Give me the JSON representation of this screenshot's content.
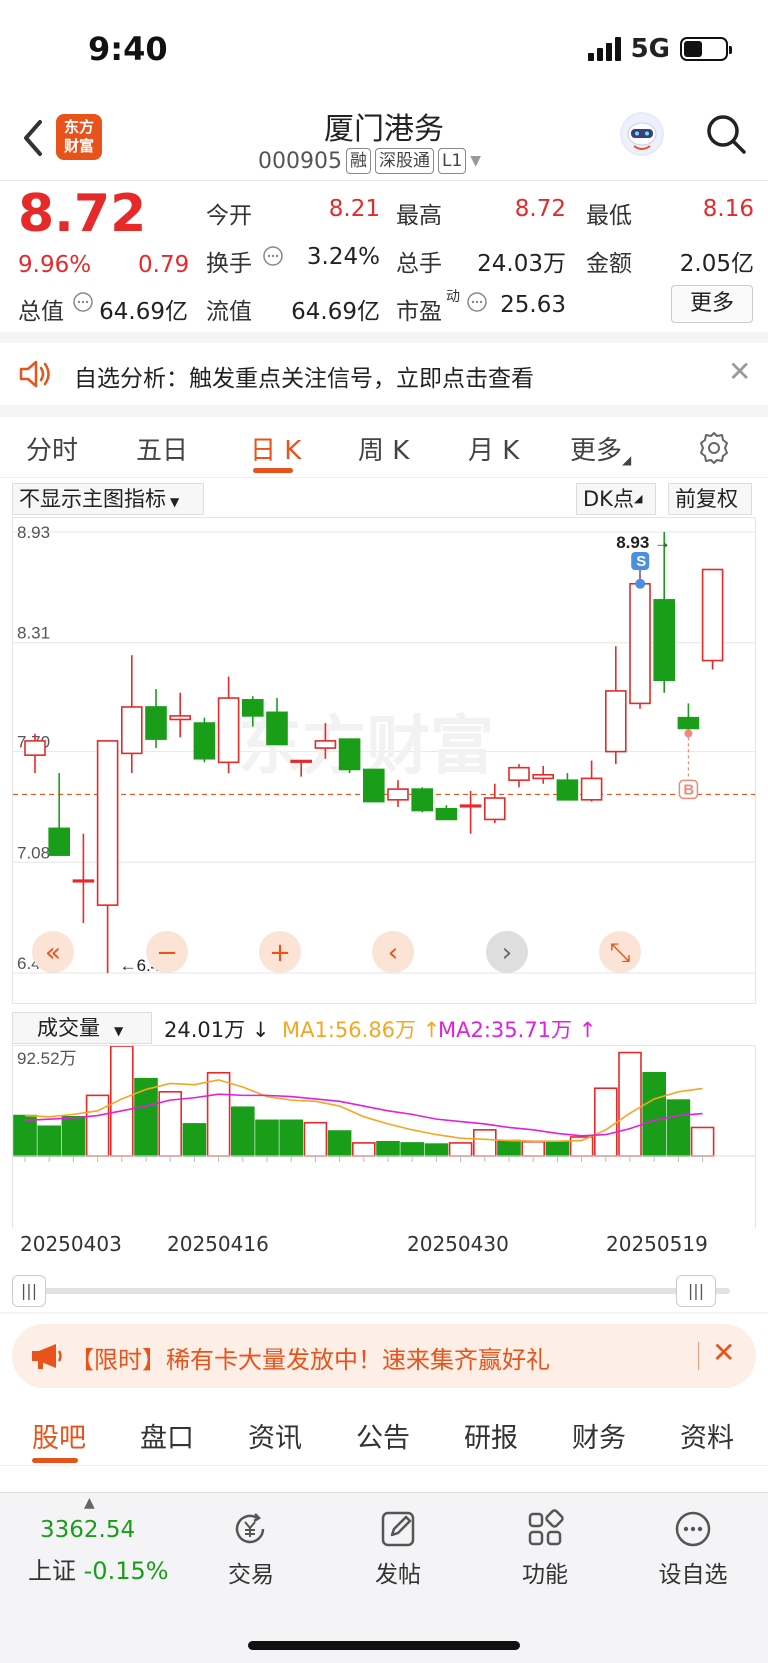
{
  "status_bar": {
    "time": "9:40",
    "network": "5G"
  },
  "header": {
    "back_icon": "chevron-left-icon",
    "logo_text": "东方财富",
    "stock_name": "厦门港务",
    "stock_code": "000905",
    "tags": [
      "融",
      "深股通",
      "L1"
    ]
  },
  "quote": {
    "price": "8.72",
    "change_pct": "9.96%",
    "change": "0.79",
    "fields": [
      {
        "label": "今开",
        "value": "8.21",
        "color": "#e62a2a"
      },
      {
        "label": "最高",
        "value": "8.72",
        "color": "#e62a2a"
      },
      {
        "label": "最低",
        "value": "8.16",
        "color": "#e62a2a"
      },
      {
        "label": "换手",
        "value": "3.24%",
        "color": "#222"
      },
      {
        "label": "总手",
        "value": "24.03万",
        "color": "#222"
      },
      {
        "label": "金额",
        "value": "2.05亿",
        "color": "#222"
      },
      {
        "label": "总值",
        "value": "64.69亿",
        "color": "#222"
      },
      {
        "label": "流值",
        "value": "64.69亿",
        "color": "#222"
      },
      {
        "label": "市盈",
        "value": "25.63",
        "color": "#222"
      }
    ],
    "pe_superscript": "动",
    "more_label": "更多"
  },
  "notice": {
    "text": "自选分析：触发重点关注信号，立即点击查看"
  },
  "period_tabs": [
    "分时",
    "五日",
    "日 K",
    "周 K",
    "月 K",
    "更多"
  ],
  "active_tab": "日 K",
  "chart_controls": {
    "indicator_select": "不显示主图指标",
    "dk_label": "DK点",
    "adjust_label": "前复权"
  },
  "chart_data": [
    {
      "type": "candlestick",
      "y_ticks": [
        "8.93",
        "8.31",
        "7.70",
        "7.08",
        "6.46"
      ],
      "ylim": [
        6.46,
        8.93
      ],
      "current_price_line": 7.46,
      "annotations": [
        {
          "text": "8.93",
          "marker": "S"
        },
        {
          "text": "6.46"
        },
        {
          "marker": "B"
        }
      ],
      "candles": [
        {
          "o": 7.68,
          "h": 7.8,
          "l": 7.58,
          "c": 7.76
        },
        {
          "o": 7.27,
          "h": 7.58,
          "l": 7.2,
          "c": 7.12
        },
        {
          "o": 6.98,
          "h": 7.24,
          "l": 6.74,
          "c": 6.98
        },
        {
          "o": 6.84,
          "h": 7.76,
          "l": 6.46,
          "c": 7.76
        },
        {
          "o": 7.69,
          "h": 8.24,
          "l": 7.58,
          "c": 7.95
        },
        {
          "o": 7.95,
          "h": 8.05,
          "l": 7.72,
          "c": 7.77
        },
        {
          "o": 7.88,
          "h": 8.03,
          "l": 7.78,
          "c": 7.9
        },
        {
          "o": 7.86,
          "h": 7.89,
          "l": 7.64,
          "c": 7.66
        },
        {
          "o": 7.64,
          "h": 8.12,
          "l": 7.58,
          "c": 8.0
        },
        {
          "o": 7.99,
          "h": 8.01,
          "l": 7.84,
          "c": 7.9
        },
        {
          "o": 7.92,
          "h": 8.0,
          "l": 7.77,
          "c": 7.74
        },
        {
          "o": 7.65,
          "h": 7.65,
          "l": 7.56,
          "c": 7.65
        },
        {
          "o": 7.72,
          "h": 7.86,
          "l": 7.66,
          "c": 7.76
        },
        {
          "o": 7.77,
          "h": 7.77,
          "l": 7.58,
          "c": 7.6
        },
        {
          "o": 7.6,
          "h": 7.6,
          "l": 7.42,
          "c": 7.42
        },
        {
          "o": 7.43,
          "h": 7.54,
          "l": 7.39,
          "c": 7.49
        },
        {
          "o": 7.49,
          "h": 7.5,
          "l": 7.36,
          "c": 7.37
        },
        {
          "o": 7.38,
          "h": 7.4,
          "l": 7.32,
          "c": 7.32
        },
        {
          "o": 7.4,
          "h": 7.48,
          "l": 7.24,
          "c": 7.4
        },
        {
          "o": 7.32,
          "h": 7.52,
          "l": 7.3,
          "c": 7.44
        },
        {
          "o": 7.54,
          "h": 7.63,
          "l": 7.5,
          "c": 7.61
        },
        {
          "o": 7.55,
          "h": 7.62,
          "l": 7.52,
          "c": 7.57
        },
        {
          "o": 7.54,
          "h": 7.58,
          "l": 7.43,
          "c": 7.43
        },
        {
          "o": 7.43,
          "h": 7.65,
          "l": 7.42,
          "c": 7.55
        },
        {
          "o": 7.7,
          "h": 8.29,
          "l": 7.63,
          "c": 8.04
        },
        {
          "o": 7.97,
          "h": 8.72,
          "l": 7.94,
          "c": 8.64
        },
        {
          "o": 8.55,
          "h": 8.93,
          "l": 8.03,
          "c": 8.1
        },
        {
          "o": 7.89,
          "h": 7.97,
          "l": 7.79,
          "c": 7.83
        },
        {
          "o": 8.21,
          "h": 8.72,
          "l": 8.16,
          "c": 8.72
        }
      ]
    },
    {
      "type": "bar",
      "name": "成交量",
      "y_tick": "92.52万",
      "ylim": [
        0,
        92.52
      ],
      "values": [
        34,
        25,
        33,
        51,
        92.5,
        65,
        54,
        27,
        70,
        41,
        30,
        30,
        28,
        21,
        11,
        12,
        11,
        10,
        11,
        22,
        13,
        12,
        12,
        16,
        57,
        87,
        70,
        47,
        24
      ],
      "up": [
        false,
        false,
        false,
        true,
        true,
        false,
        true,
        false,
        true,
        false,
        false,
        false,
        true,
        false,
        true,
        false,
        false,
        false,
        true,
        true,
        false,
        true,
        false,
        true,
        true,
        true,
        false,
        false,
        true
      ],
      "ma1": [
        34,
        33,
        35,
        38,
        48,
        56,
        61,
        60,
        64,
        58,
        50,
        47,
        46,
        42,
        33,
        27,
        22,
        18,
        15,
        14,
        13,
        12.5,
        12.5,
        13,
        22,
        36,
        48,
        54,
        56.86
      ],
      "ma2": [
        30,
        31,
        32,
        34,
        38,
        42,
        47,
        49,
        52,
        51,
        51,
        50,
        48,
        46,
        42,
        38,
        35,
        31,
        29,
        27,
        24,
        22,
        19,
        17,
        18,
        23,
        30,
        34,
        35.71
      ],
      "legend": {
        "current": "24.01万",
        "ma1": "MA1:56.86万",
        "ma2": "MA2:35.71万"
      }
    }
  ],
  "x_dates": [
    "20250403",
    "20250416",
    "20250430",
    "20250519"
  ],
  "colors": {
    "up": "#e62a2a",
    "down": "#1a9e1a",
    "ma1": "#f5a623",
    "ma2": "#e020e0",
    "accent": "#e8531c"
  },
  "promo": {
    "text": "【限时】稀有卡大量发放中！速来集齐赢好礼"
  },
  "bottom_tabs": [
    "股吧",
    "盘口",
    "资讯",
    "公告",
    "研报",
    "财务",
    "资料"
  ],
  "active_bottom_tab": "股吧",
  "nav": {
    "index_value": "3362.54",
    "index_name": "上证",
    "index_change": "-0.15%",
    "items": [
      {
        "label": "交易",
        "icon": "yen-exchange-icon"
      },
      {
        "label": "发帖",
        "icon": "edit-icon"
      },
      {
        "label": "功能",
        "icon": "grid-icon"
      },
      {
        "label": "设自选",
        "icon": "more-circle-icon"
      }
    ]
  }
}
